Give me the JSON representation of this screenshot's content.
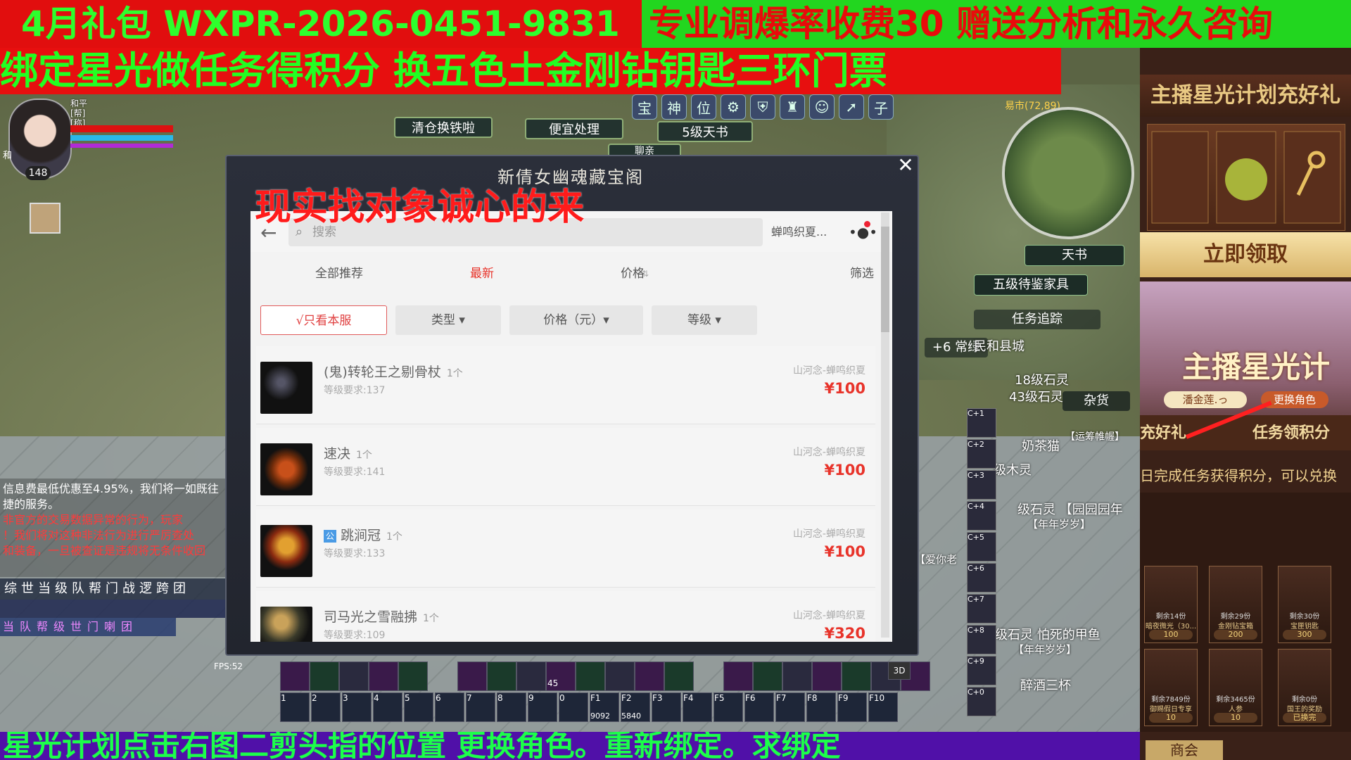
{
  "banners": {
    "top_left": "4月礼包 WXPR-2026-0451-9831",
    "top_right": "专业调爆率收费30  赠送分析和永久咨询",
    "second": "绑定星光做任务得积分     换五色土金刚钻钥匙三环门票",
    "bottom": "星光计划点击右图二剪头指的位置     更换角色。重新绑定。求绑定"
  },
  "player": {
    "level": "148",
    "info_lines": [
      "和平",
      "[帮]",
      "[称]"
    ],
    "stance": "和"
  },
  "npc_labels": {
    "warehouse": "清仓换铁啦",
    "cheap": "便宜处理",
    "level5_book": "5级天书",
    "chat_label": "聊亲"
  },
  "top_icons": [
    "宝",
    "神",
    "位",
    "子"
  ],
  "minimap": {
    "coord": "易市(72,89)",
    "tiangshu": "天书",
    "appraise": "五级待鉴家具",
    "quest_track": "任务追踪",
    "general": "杂货",
    "plus6": "+6 常绿"
  },
  "chat": {
    "lines": [
      {
        "text": "信息费最低优惠至4.95%，我们将一如既往",
        "color": "#ffffff"
      },
      {
        "text": "捷的服务。",
        "color": "#ffffff"
      },
      {
        "text": "    非官方的交易数据异常的行为，玩家",
        "color": "#ff3a3a"
      },
      {
        "text": "！我们将对这种非法行为进行严厉查处",
        "color": "#ff3a3a"
      },
      {
        "text": "和装备，一旦被查证是违规将无条件收回",
        "color": "#ff3a3a"
      }
    ],
    "tabs": "综世当级队帮门战逻跨团",
    "tools2": "当队帮级世门喇团"
  },
  "team_list": [
    {
      "text": "民和县城",
      "color": "#7cff6a"
    },
    {
      "text": "18级石灵",
      "color": "#ff5aa8"
    },
    {
      "text": "43级石灵",
      "color": "#ff5aa8"
    },
    {
      "text": "奶茶猫",
      "color": "#ffd24a"
    },
    {
      "text": "【运筹帷幄】",
      "color": "#8fd0ff"
    },
    {
      "text": "级木灵",
      "color": "#ff6a6a"
    },
    {
      "text": "级石灵 【园园园年",
      "color": "#7cff6a"
    },
    {
      "text": "【年年岁岁】",
      "color": "#ffd24a"
    },
    {
      "text": "【爱你老",
      "color": "#ff9ae0"
    },
    {
      "text": "级石灵 怕死的甲鱼",
      "color": "#7cff6a"
    },
    {
      "text": "【年年岁岁】",
      "color": "#ffd24a"
    },
    {
      "text": "醉酒三杯",
      "color": "#7cff6a"
    }
  ],
  "hotbar": {
    "fps": "FPS:52",
    "top_row": [
      "",
      "45",
      "",
      "",
      "",
      "",
      "",
      "",
      "3D"
    ],
    "bottom_row": [
      "1",
      "2",
      "3",
      "4",
      "5",
      "6",
      "7",
      "8",
      "9",
      "0",
      "F1",
      "F2",
      "F3",
      "F4",
      "F5",
      "F6",
      "F7",
      "F8",
      "F9",
      "F10"
    ],
    "counts": [
      "9092",
      "5840"
    ]
  },
  "modal": {
    "title": "新倩女幽魂藏宝阁",
    "overlay_text": "现实找对象诚心的来",
    "close": "✕"
  },
  "app": {
    "search_placeholder": "搜索",
    "user": "蝉鸣织夏...",
    "sort": {
      "all": "全部推荐",
      "latest": "最新",
      "price": "价格",
      "filter": "筛选"
    },
    "filter_chips": {
      "only_server": "√只看本服",
      "type": "类型 ▾",
      "price_range": "价格（元）▾",
      "level": "等级 ▾"
    },
    "items": [
      {
        "name": "(鬼)转轮王之剔骨杖",
        "qty": "1个",
        "level": "等级要求:137",
        "seller": "山河念-蝉鸣织夏",
        "price": "¥100",
        "tag": ""
      },
      {
        "name": "速决",
        "qty": "1个",
        "level": "等级要求:141",
        "seller": "山河念-蝉鸣织夏",
        "price": "¥100",
        "tag": ""
      },
      {
        "name": "跳涧冠",
        "qty": "1个",
        "level": "等级要求:133",
        "seller": "山河念-蝉鸣织夏",
        "price": "¥100",
        "tag": "公"
      },
      {
        "name": "司马光之雪融拂",
        "qty": "1个",
        "level": "等级要求:109",
        "seller": "山河念-蝉鸣织夏",
        "price": "¥320",
        "tag": ""
      }
    ]
  },
  "right_panel": {
    "header": "主播星光计划充好礼",
    "claim": "立即领取",
    "art_title": "主播星光计",
    "streamer": "潘金莲.っ",
    "swap_role": "更换角色",
    "tab_gift": "充好礼",
    "tab_points": "任务领积分",
    "desc": "日完成任务获得积分，可以兑换",
    "shop": [
      {
        "remain": "剩余14份",
        "name": "暗夜微光（30...",
        "cost": "100"
      },
      {
        "remain": "剩余29份",
        "name": "金刚钻宝箱",
        "cost": "200"
      },
      {
        "remain": "剩余30份",
        "name": "宝匣钥匙",
        "cost": "300"
      },
      {
        "remain": "剩余7849份",
        "name": "御赐假日专享",
        "cost": "10"
      },
      {
        "remain": "剩余3465份",
        "name": "人参",
        "cost": "10"
      },
      {
        "remain": "剩余0份",
        "name": "国王的奖励",
        "cost": "已换完"
      }
    ],
    "bottom_tab": "商会"
  }
}
